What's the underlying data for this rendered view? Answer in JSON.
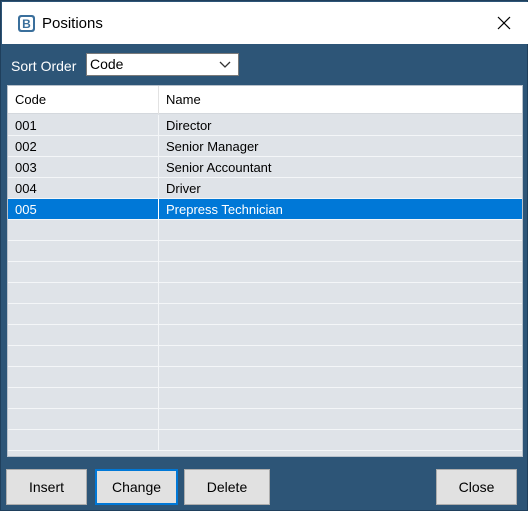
{
  "window": {
    "title": "Positions"
  },
  "toolbar": {
    "sort_label": "Sort Order",
    "sort_value": "Code"
  },
  "grid": {
    "columns": [
      "Code",
      "Name"
    ],
    "rows": [
      {
        "code": "001",
        "name": "Director"
      },
      {
        "code": "002",
        "name": "Senior Manager"
      },
      {
        "code": "003",
        "name": "Senior Accountant"
      },
      {
        "code": "004",
        "name": "Driver"
      },
      {
        "code": "005",
        "name": "Prepress Technician"
      }
    ],
    "selected_code": "005"
  },
  "buttons": {
    "insert": "Insert",
    "change": "Change",
    "delete": "Delete",
    "close": "Close"
  },
  "colors": {
    "frame": "#2d5577",
    "selection": "#0078d7",
    "grid_bg": "#dfe3e8"
  },
  "icons": {
    "app": "app-logo-icon",
    "close": "close-icon",
    "dropdown": "chevron-down-icon"
  }
}
